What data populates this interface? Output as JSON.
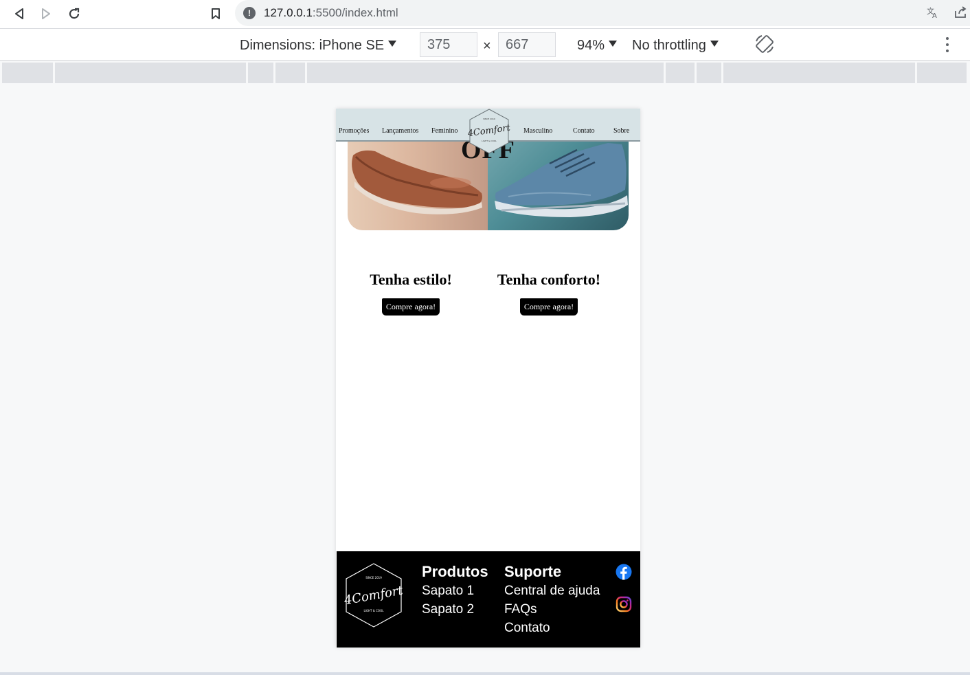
{
  "browser": {
    "url_host": "127.0.0.1",
    "url_path": ":5500/index.html"
  },
  "devtools": {
    "dimensions_label": "Dimensions: iPhone SE",
    "width": "375",
    "height": "667",
    "times": "×",
    "zoom": "94%",
    "throttling": "No throttling"
  },
  "site": {
    "nav_left": [
      "Promoções",
      "Lançamentos",
      "Feminino"
    ],
    "nav_right": [
      "Masculino",
      "Contato",
      "Sobre"
    ],
    "logo_text": "4Comfort",
    "logo_since": "SINCE 2019",
    "logo_tagline": "LIGHT & COOL",
    "hero_text": "OFF",
    "promos": [
      {
        "title": "Tenha estilo!",
        "button": "Compre agora!"
      },
      {
        "title": "Tenha conforto!",
        "button": "Compre agora!"
      }
    ],
    "footer": {
      "produtos_title": "Produtos",
      "produtos": [
        "Sapato 1",
        "Sapato 2"
      ],
      "suporte_title": "Suporte",
      "suporte": [
        "Central de ajuda",
        "FAQs",
        "Contato"
      ],
      "social_icons": [
        "facebook-icon",
        "instagram-icon"
      ]
    }
  },
  "colors": {
    "header_bg": "#d7e3e6",
    "footer_bg": "#000000",
    "button_bg": "#000000",
    "facebook": "#1877f2"
  }
}
